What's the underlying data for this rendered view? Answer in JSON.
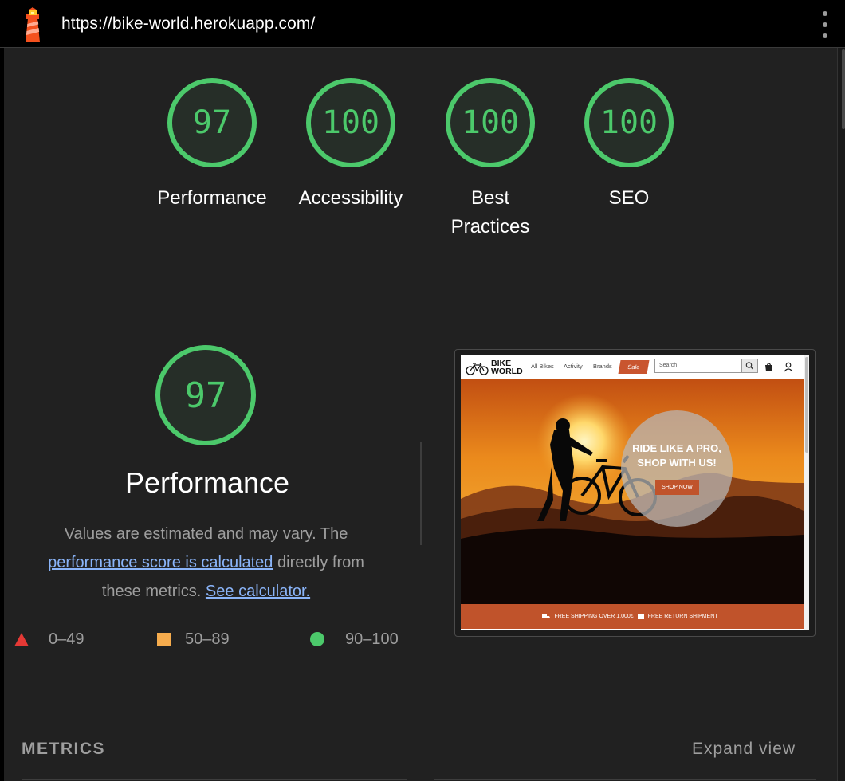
{
  "topbar": {
    "url": "https://bike-world.herokuapp.com/"
  },
  "gauges": [
    {
      "score": "97",
      "label": "Performance",
      "value": 0.97
    },
    {
      "score": "100",
      "label": "Accessibility",
      "value": 1.0
    },
    {
      "score": "100",
      "label_line1": "Best",
      "label_line2": "Practices",
      "value": 1.0
    },
    {
      "score": "100",
      "label": "SEO",
      "value": 1.0
    }
  ],
  "performance": {
    "score": "97",
    "value": 0.97,
    "title": "Performance",
    "desc_1": "Values are estimated and may vary. The",
    "link_score": "performance score is calculated",
    "desc_2": "directly from",
    "desc_3": "these metrics.",
    "link_calc": "See calculator.",
    "legend": {
      "fail": "0–49",
      "average": "50–89",
      "pass": "90–100"
    }
  },
  "screenshot": {
    "logo_line1": "BIKE",
    "logo_line2": "WORLD",
    "nav": [
      "All Bikes",
      "Activity",
      "Brands"
    ],
    "sale": "Sale",
    "search_placeholder": "Search",
    "hero_line1": "RIDE LIKE A PRO,",
    "hero_line2": "SHOP WITH US!",
    "shop_button": "SHOP NOW",
    "promo_1": "FREE SHIPPING OVER 1,000€",
    "promo_2": "FREE RETURN SHIPMENT"
  },
  "metrics": {
    "heading": "METRICS",
    "expand": "Expand view"
  },
  "colors": {
    "pass": "#4cc96b",
    "average": "#f6ac4d",
    "fail": "#e53935",
    "link": "#8ab4f8"
  }
}
